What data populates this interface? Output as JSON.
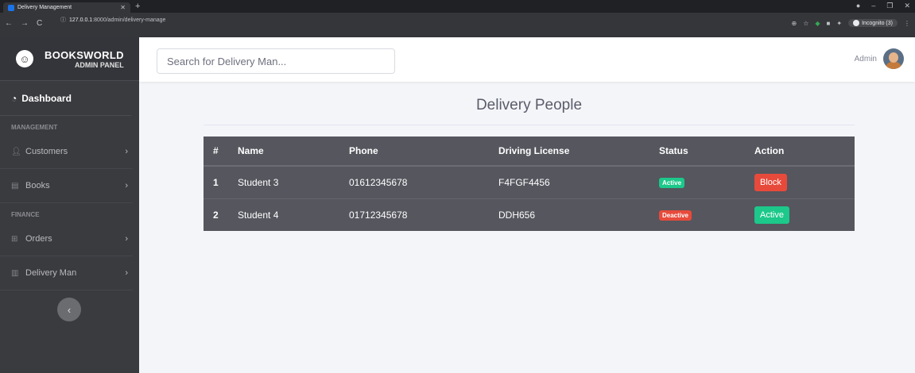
{
  "browser": {
    "tab_title": "Delivery Management",
    "url_host": "127.0.0.1",
    "url_path": ":8000/admin/delivery-manage",
    "incognito_label": "Incognito (3)"
  },
  "sidebar": {
    "brand_title": "BOOKSWORLD",
    "brand_subtitle": "ADMIN PANEL",
    "dashboard_label": "Dashboard",
    "section_management": "MANAGEMENT",
    "section_finance": "FINANCE",
    "items": [
      {
        "label": "Customers",
        "icon": "user-icon"
      },
      {
        "label": "Books",
        "icon": "book-icon"
      },
      {
        "label": "Orders",
        "icon": "table-icon"
      },
      {
        "label": "Delivery Man",
        "icon": "chart-icon"
      }
    ]
  },
  "topbar": {
    "search_placeholder": "Search for Delivery Man...",
    "user_name": "Admin"
  },
  "main": {
    "title": "Delivery People",
    "columns": [
      "#",
      "Name",
      "Phone",
      "Driving License",
      "Status",
      "Action"
    ],
    "rows": [
      {
        "num": "1",
        "name": "Student 3",
        "phone": "01612345678",
        "license": "F4FGF4456",
        "status": "Active",
        "status_color": "#1cc88a",
        "action": "Block",
        "action_color": "#e74a3b"
      },
      {
        "num": "2",
        "name": "Student 4",
        "phone": "01712345678",
        "license": "DDH656",
        "status": "Deactive",
        "status_color": "#e74a3b",
        "action": "Active",
        "action_color": "#1cc88a"
      }
    ]
  }
}
